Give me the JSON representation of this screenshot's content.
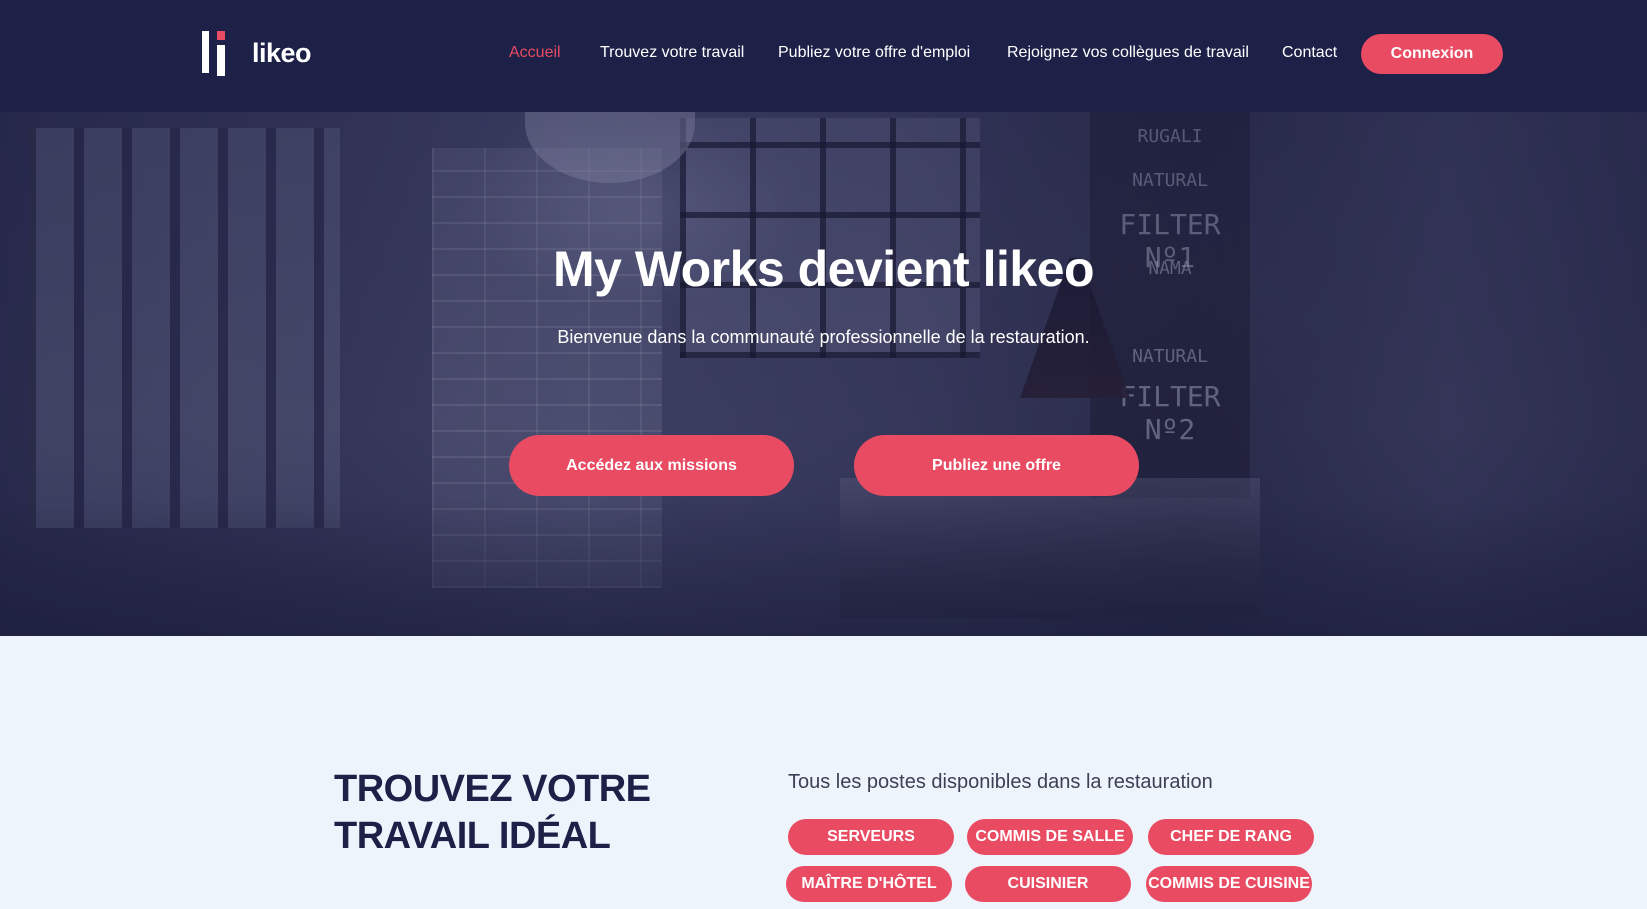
{
  "brand": {
    "name": "likeo"
  },
  "nav": {
    "items": [
      {
        "label": "Accueil",
        "active": true
      },
      {
        "label": "Trouvez votre travail",
        "active": false
      },
      {
        "label": "Publiez votre offre d'emploi",
        "active": false
      },
      {
        "label": "Rejoignez vos collègues de travail",
        "active": false
      },
      {
        "label": "Contact",
        "active": false
      }
    ],
    "login_label": "Connexion"
  },
  "hero": {
    "title_light": "My Works ",
    "title_bold": "devient likeo",
    "subtitle": "Bienvenue dans la communauté professionnelle de la restauration.",
    "cta_missions": "Accédez aux missions",
    "cta_offer": "Publiez une offre"
  },
  "jobs": {
    "title_line1": "TROUVEZ VOTRE",
    "title_line2": "TRAVAIL IDÉAL",
    "lead": "Tous les postes disponibles dans la restauration",
    "tags": [
      "SERVEURS",
      "COMMIS DE SALLE",
      "CHEF DE RANG",
      "MAÎTRE D'HÔTEL",
      "CUISINIER",
      "COMMIS DE CUISINE"
    ]
  },
  "colors": {
    "navy": "#1d2047",
    "accent": "#e94b62",
    "section_bg": "#eef4fc"
  }
}
